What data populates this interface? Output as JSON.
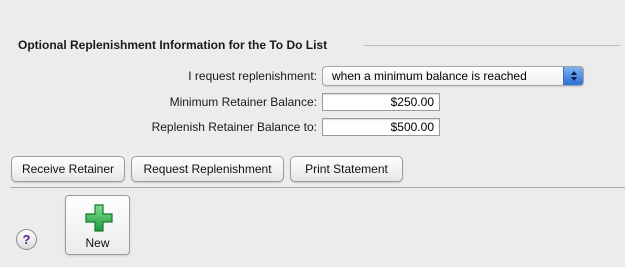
{
  "section": {
    "title": "Optional Replenishment Information for the To Do List"
  },
  "form": {
    "request_label": "I request replenishment:",
    "request_value": "when a minimum balance is reached",
    "min_label": "Minimum Retainer Balance:",
    "min_value": "$250.00",
    "replenish_label": "Replenish Retainer Balance to:",
    "replenish_value": "$500.00"
  },
  "buttons": {
    "receive": "Receive Retainer",
    "request": "Request Replenishment",
    "print": "Print Statement"
  },
  "footer": {
    "help": "?",
    "new_label": "New"
  },
  "icons": {
    "select_arrows": "up-down-arrows-icon",
    "plus": "green-plus-icon",
    "help": "help-icon"
  },
  "colors": {
    "plus_green": "#2aa84a",
    "select_accent": "#2b70d8",
    "help_text": "#5a1f8a"
  }
}
